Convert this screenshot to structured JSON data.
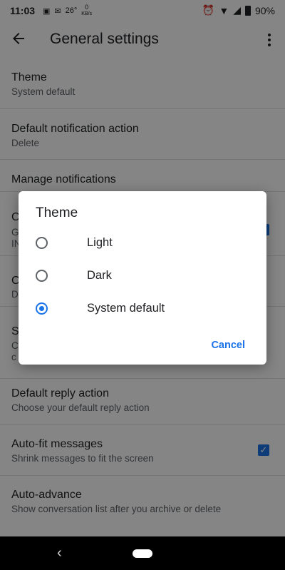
{
  "status_bar": {
    "time": "11:03",
    "temperature": "26°",
    "net_speed": "0",
    "net_unit": "KB/s",
    "battery": "90%"
  },
  "app_bar": {
    "title": "General settings"
  },
  "settings": [
    {
      "title": "Theme",
      "subtitle": "System default"
    },
    {
      "title": "Default notification action",
      "subtitle": "Delete"
    },
    {
      "title": "Manage notifications",
      "subtitle": ""
    },
    {
      "title": "Default reply action",
      "subtitle": "Choose your default reply action"
    },
    {
      "title": "Auto-fit messages",
      "subtitle": "Shrink messages to fit the screen",
      "checked": true
    },
    {
      "title": "Auto-advance",
      "subtitle": "Show conversation list after you archive or delete"
    }
  ],
  "partial_items": {
    "item_a_title": "C",
    "item_a_sub1": "G",
    "item_a_sub2": "IN",
    "item_b_title": "C",
    "item_b_sub": "D",
    "item_c_title": "S",
    "item_c_sub1": "C",
    "item_c_sub2": "c"
  },
  "dialog": {
    "title": "Theme",
    "options": [
      {
        "label": "Light",
        "selected": false
      },
      {
        "label": "Dark",
        "selected": false
      },
      {
        "label": "System default",
        "selected": true
      }
    ],
    "cancel_label": "Cancel"
  },
  "colors": {
    "accent": "#1a73e8",
    "scrim": "rgba(0,0,0,0.48)"
  },
  "nav_bar": {
    "back_icon": "chevron-left-icon",
    "home_icon": "home-pill-icon"
  }
}
